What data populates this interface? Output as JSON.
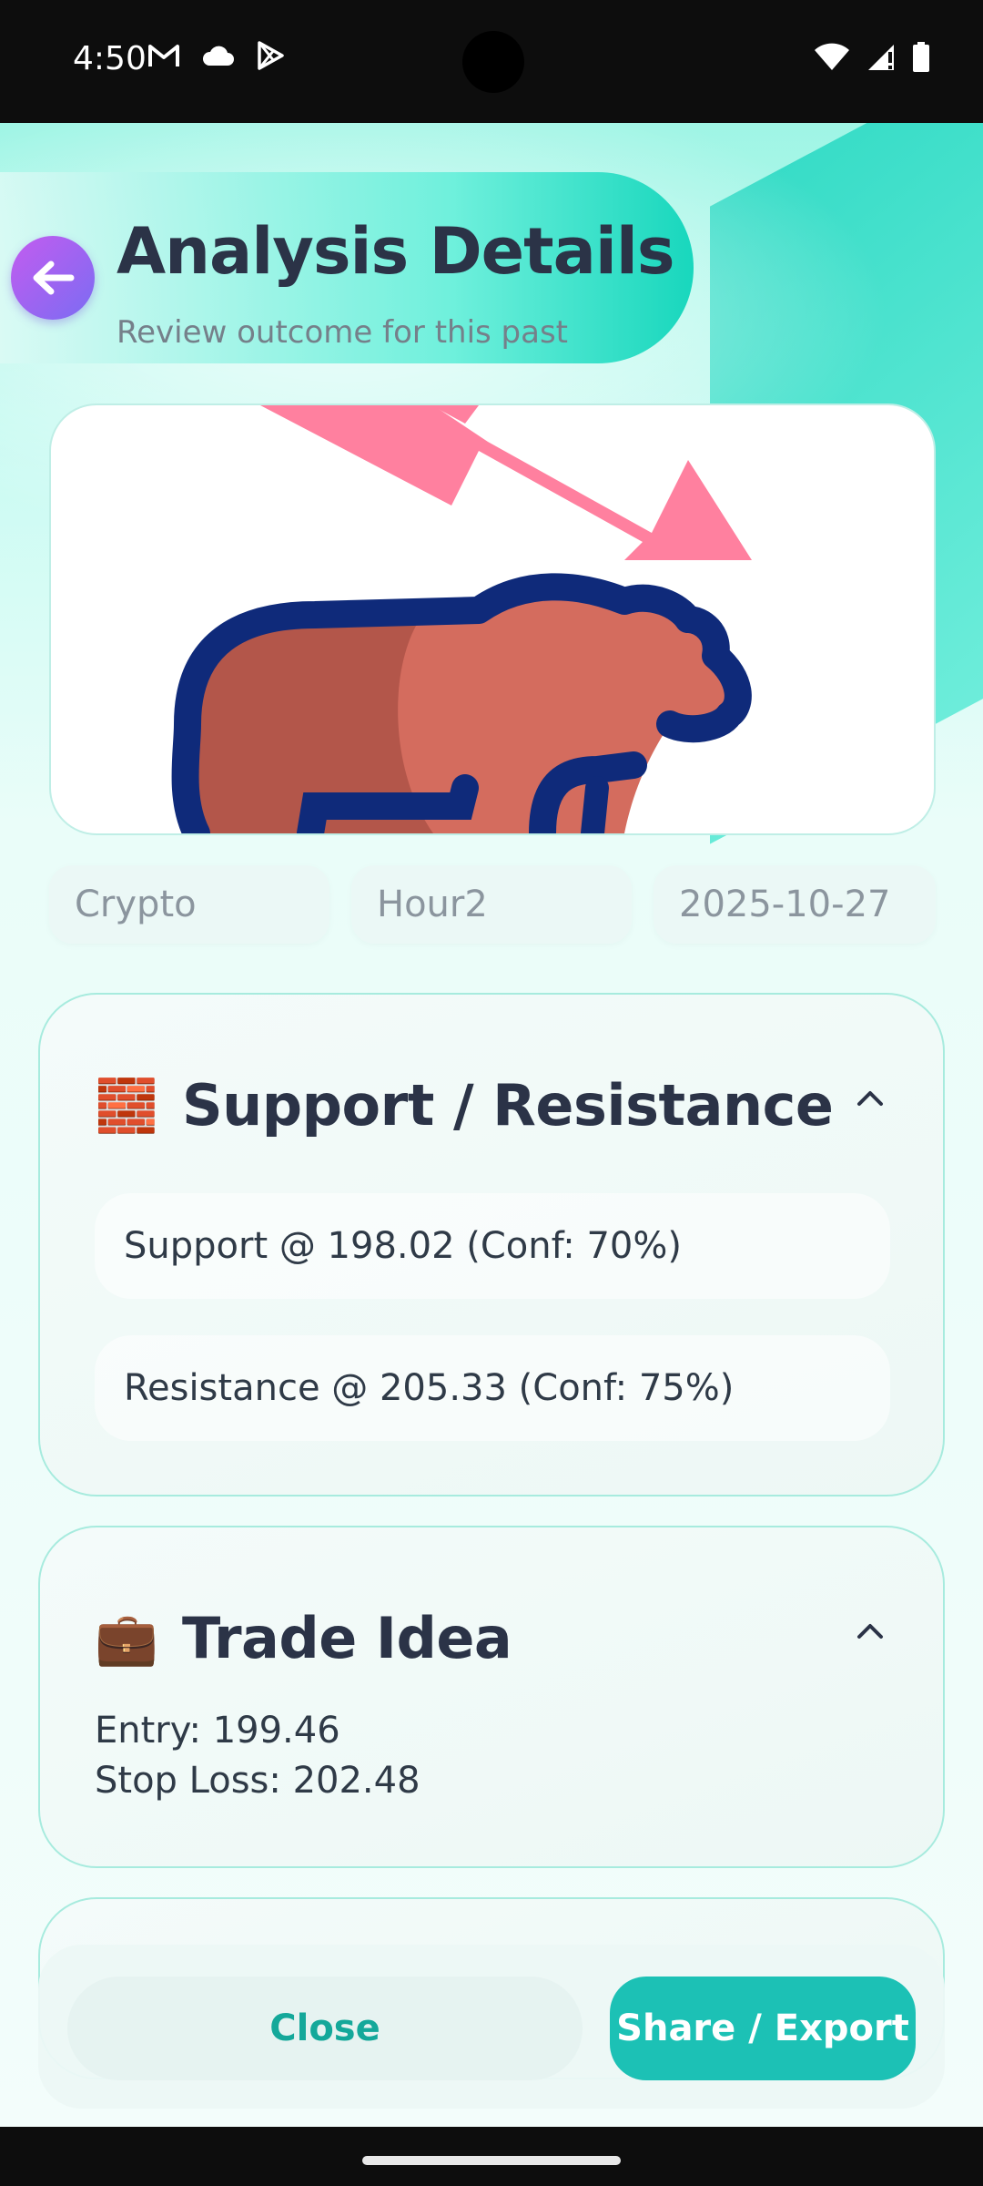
{
  "status_bar": {
    "time": "4:50",
    "left_icons": [
      "gmail-icon",
      "cloud-icon",
      "play-store-icon"
    ],
    "right_icons": [
      "wifi-icon",
      "signal-icon",
      "battery-icon"
    ]
  },
  "header": {
    "title": "Analysis Details",
    "subtitle": "Review outcome for this past"
  },
  "hero_image": {
    "description_icon": "bear-market-icon"
  },
  "chips": [
    "Crypto",
    "Hour2",
    "2025-10-27"
  ],
  "support_resistance": {
    "emoji": "🧱",
    "title": "Support / Resistance",
    "levels": [
      "Support @ 198.02  (Conf: 70%)",
      "Resistance @ 205.33  (Conf: 75%)"
    ]
  },
  "trade_idea": {
    "emoji": "💼",
    "title": "Trade Idea",
    "entry": "Entry: 199.46",
    "stop_loss": "Stop Loss: 202.48"
  },
  "actions": {
    "close_label": "Close",
    "share_label": "Share / Export"
  },
  "colors": {
    "accent": "#1cc1b5",
    "title_text": "#2b3347",
    "back_button_start": "#c35cf0",
    "back_button_end": "#7b6cf2"
  }
}
